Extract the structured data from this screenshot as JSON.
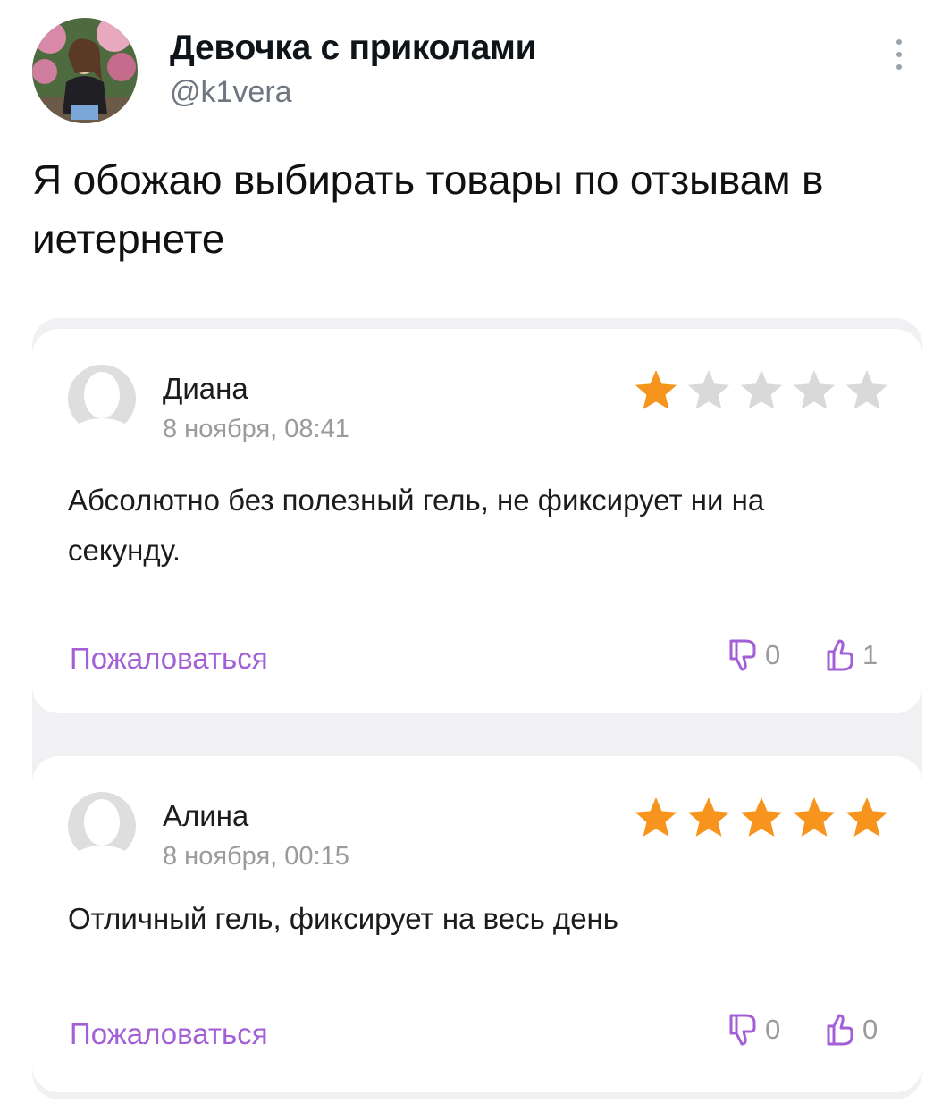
{
  "tweet": {
    "display_name": "Девочка с приколами",
    "handle": "@k1vera",
    "text": "Я обожаю выбирать товары по отзывам в иетернете",
    "more_icon": "more-vertical-icon"
  },
  "reviews": [
    {
      "name": "Диана",
      "date": "8 ноября, 08:41",
      "rating": 1,
      "max_rating": 5,
      "text": "Абсолютно без полезный гель, не фиксирует ни на секунду.",
      "report_label": "Пожаловаться",
      "dislikes": "0",
      "likes": "1"
    },
    {
      "name": "Алина",
      "date": "8 ноября, 00:15",
      "rating": 5,
      "max_rating": 5,
      "text": "Отличный гель, фиксирует на весь день",
      "report_label": "Пожаловаться",
      "dislikes": "0",
      "likes": "0"
    }
  ],
  "colors": {
    "star_active": "#f7941d",
    "star_inactive": "#d9d9d9",
    "report_link": "#a25fd6",
    "vote_icon": "#a25fd6"
  },
  "icons": {
    "star": "star-icon",
    "dislike": "thumbs-down-icon",
    "like": "thumbs-up-icon",
    "avatar_placeholder": "user-placeholder-icon"
  }
}
